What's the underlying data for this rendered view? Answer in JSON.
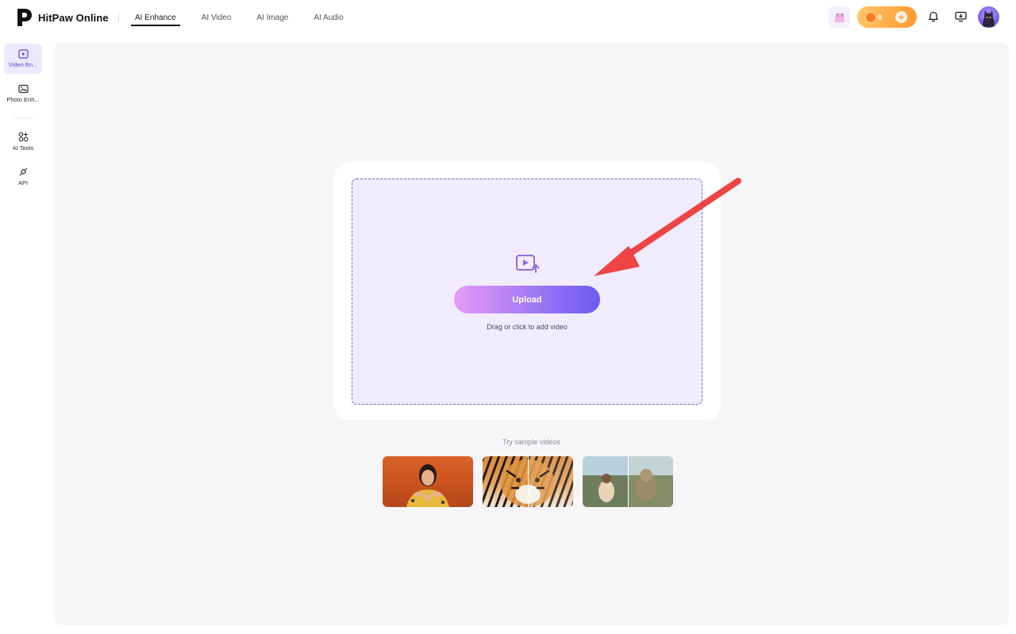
{
  "brand": {
    "name": "HitPaw Online"
  },
  "nav": {
    "tabs": [
      {
        "label": "AI Enhance",
        "active": true
      },
      {
        "label": "AI Video",
        "active": false
      },
      {
        "label": "AI Image",
        "active": false
      },
      {
        "label": "AI Audio",
        "active": false
      }
    ]
  },
  "header": {
    "credits": "0",
    "icons": [
      "gift-icon",
      "coin-icon",
      "plus-icon",
      "bell-icon",
      "desktop-download-icon",
      "user-avatar"
    ]
  },
  "sidebar": {
    "items": [
      {
        "label": "Video En...",
        "icon": "video-enhance-icon",
        "active": true
      },
      {
        "label": "Photo Enh...",
        "icon": "photo-enhance-icon",
        "active": false
      },
      {
        "label": "AI Tools",
        "icon": "ai-tools-icon",
        "active": false
      },
      {
        "label": "API",
        "icon": "api-icon",
        "active": false
      }
    ]
  },
  "upload": {
    "button_label": "Upload",
    "hint": "Drag or click to add video",
    "icon": "video-upload-icon"
  },
  "samples": {
    "title": "Try sample videos",
    "items": [
      "sample-woman",
      "sample-tiger",
      "sample-cat"
    ]
  },
  "colors": {
    "accent": "#6b5bf2",
    "accent_light": "#e79af7",
    "dropzone_bg": "#f0ecfd",
    "credits_orange": "#ff9a2e",
    "annotation_red": "#ef4444"
  }
}
